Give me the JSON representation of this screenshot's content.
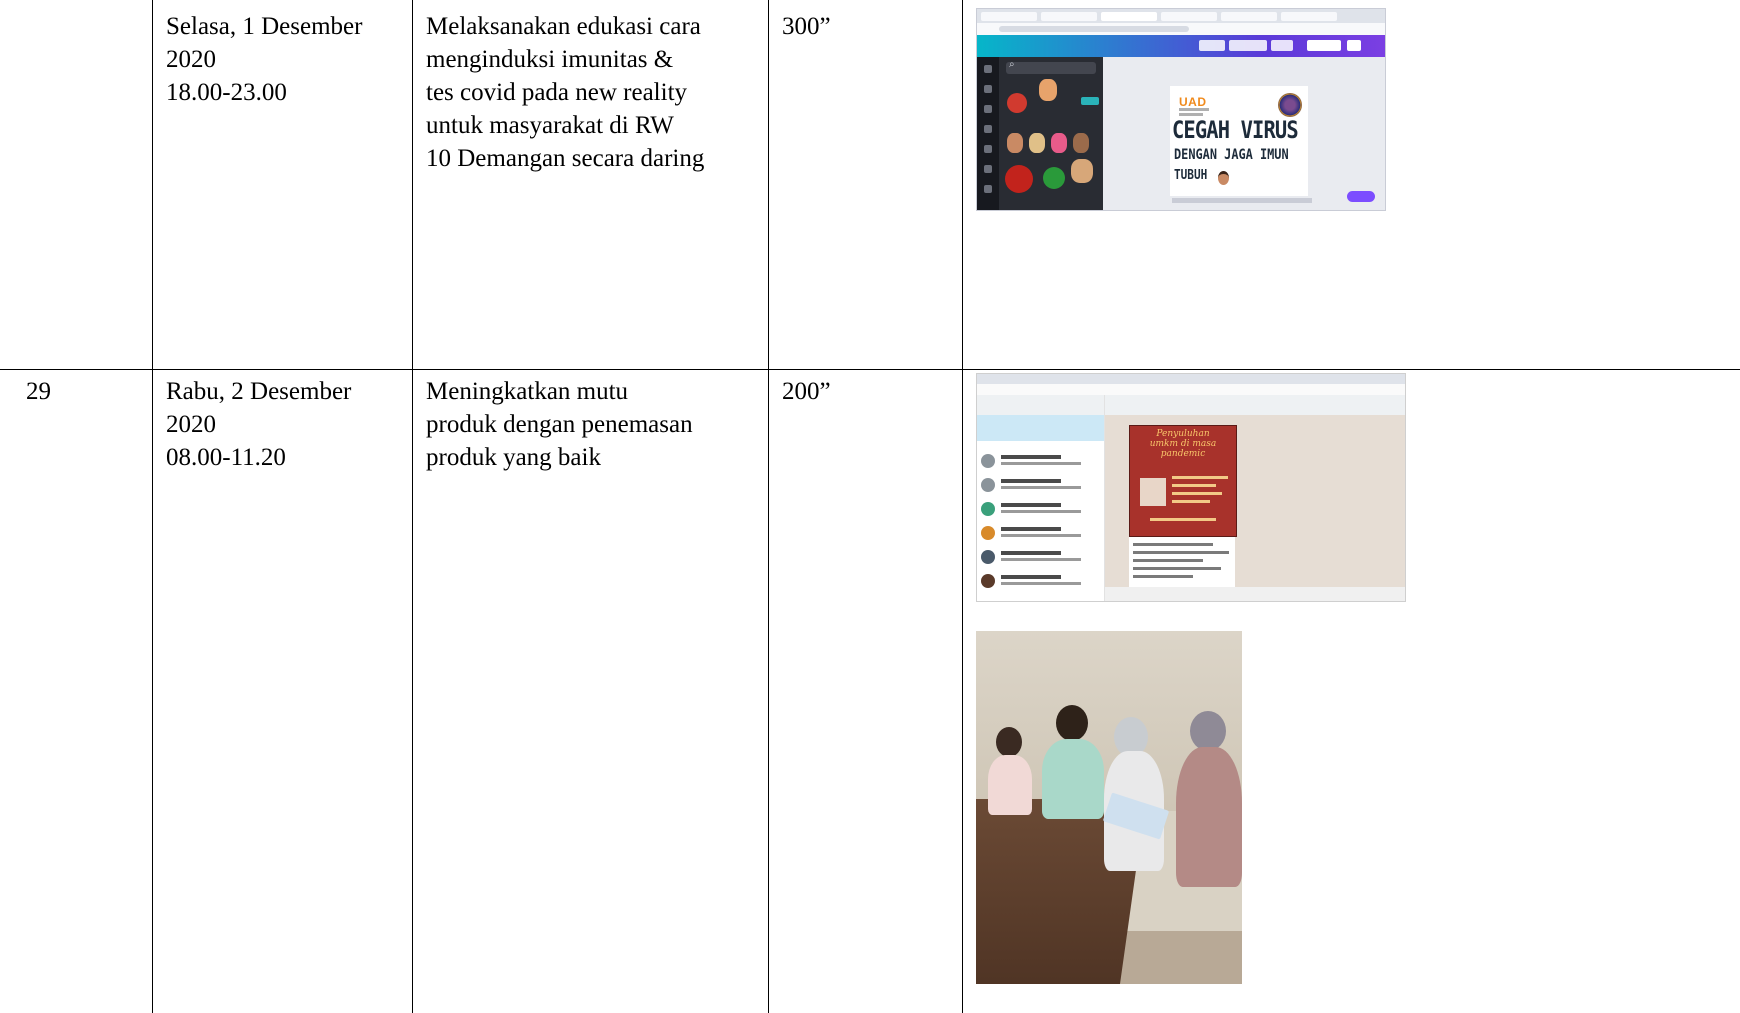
{
  "rows": [
    {
      "no": "",
      "date_lines": [
        "Selasa, 1 Desember",
        "2020",
        "18.00-23.00"
      ],
      "activity_lines": [
        "Melaksanakan edukasi cara",
        "menginduksi imunitas &",
        "tes covid  pada new reality",
        "untuk masyarakat di RW",
        "10 Demangan secara daring"
      ],
      "duration": "300”",
      "evidence": {
        "design": {
          "brand": "UAD",
          "headline": "CEGAH VIRUS",
          "line2": "DENGAN JAGA IMUN",
          "line3": "TUBUH"
        }
      }
    },
    {
      "no": "29",
      "date_lines": [
        "Rabu, 2 Desember",
        "2020",
        "08.00-11.20"
      ],
      "activity_lines": [
        "Meningkatkan mutu",
        "produk dengan penemasan",
        "produk yang baik"
      ],
      "duration": "200”",
      "evidence": {
        "poster_title_lines": [
          "Penyuluhan",
          "umkm di masa",
          "pandemic"
        ]
      }
    }
  ],
  "colors": {
    "border": "#000000",
    "canva_gradient_start": "#06b6c9",
    "canva_gradient_end": "#7b3fe3",
    "poster_red": "#a8322b",
    "uad_orange": "#f08a1c"
  }
}
